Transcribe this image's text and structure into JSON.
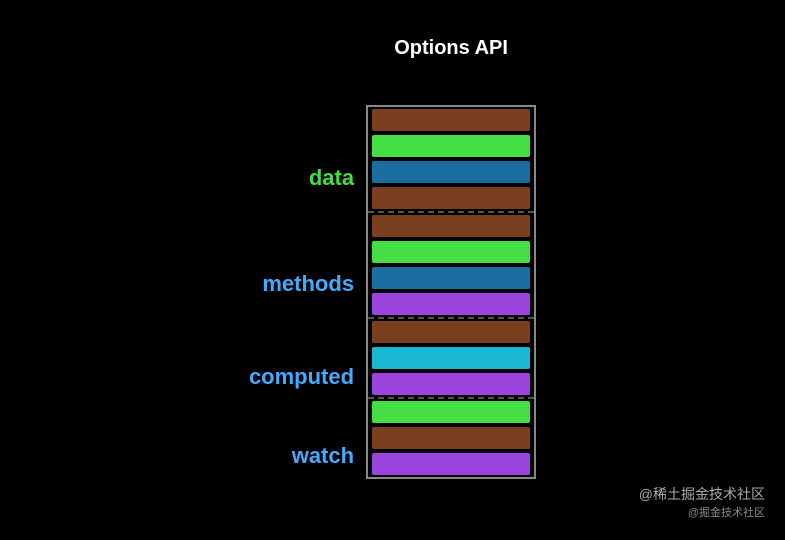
{
  "title": "Options API",
  "sections": [
    {
      "id": "data",
      "label": "data",
      "labelColor": "#44dd44",
      "bars": [
        "brown",
        "green",
        "blue-dark",
        "brown"
      ]
    },
    {
      "id": "methods",
      "label": "methods",
      "labelColor": "#44aaff",
      "bars": [
        "brown",
        "green",
        "blue-dark",
        "purple"
      ]
    },
    {
      "id": "computed",
      "label": "computed",
      "labelColor": "#44aaff",
      "bars": [
        "brown",
        "cyan",
        "purple"
      ]
    },
    {
      "id": "watch",
      "label": "watch",
      "labelColor": "#44aaff",
      "bars": [
        "green",
        "brown",
        "purple"
      ]
    }
  ],
  "watermark": {
    "main": "@稀土掘金技术社区",
    "sub": "@掘金技术社区"
  }
}
